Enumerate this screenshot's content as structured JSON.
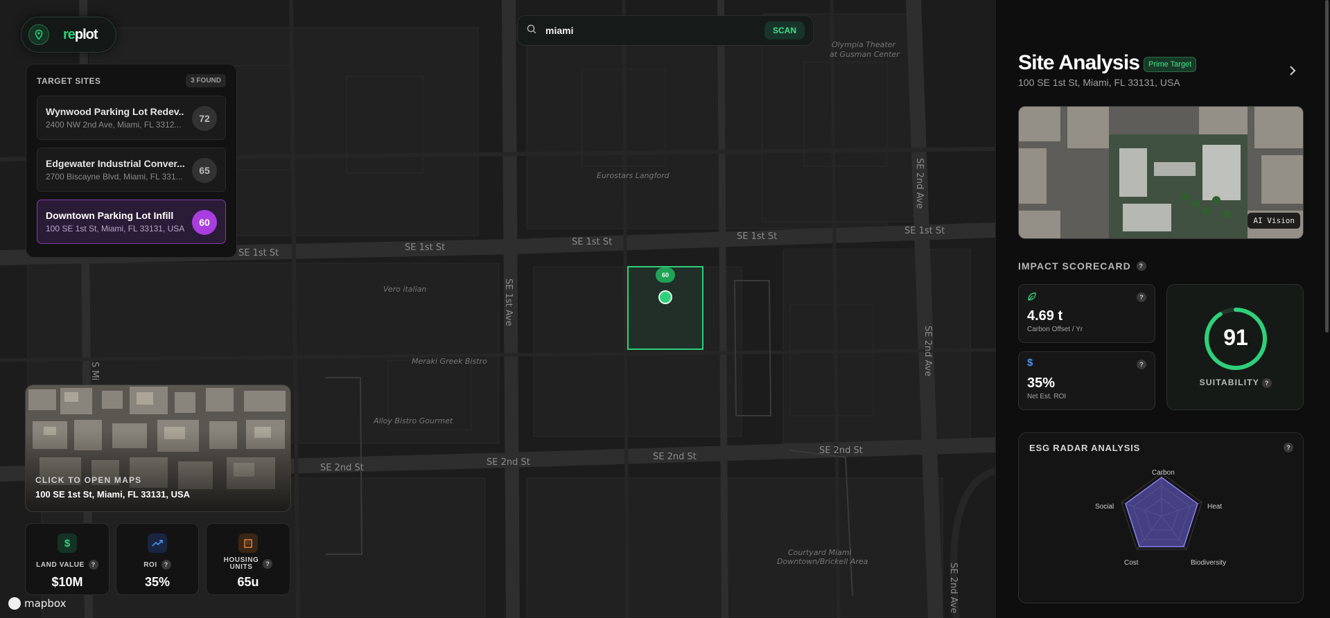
{
  "app": {
    "logo_prefix": "re",
    "logo_suffix": "plot"
  },
  "search": {
    "query": "miami",
    "scan_label": "SCAN"
  },
  "map": {
    "street_labels": [
      "SE 1st St",
      "SE 1st St",
      "SE 1st St",
      "SE 1st St",
      "SE 1st St",
      "SE 2nd St",
      "SE 2nd St",
      "SE 2nd St",
      "SE 2nd St",
      "SE 2nd Ave",
      "SE 2nd Ave",
      "SE 2nd Ave",
      "SE 1st Ave",
      "S Mi"
    ],
    "poi_labels": [
      "Olympia Theater",
      "at Gusman Center",
      "Eurostars Langford",
      "Vero italian",
      "Meraki Greek Bistro",
      "Alloy Bistro Gourmet",
      "Courtyard Miami",
      "Downtown/Brickell Area"
    ],
    "marker_score": "60",
    "attribution": "mapbox"
  },
  "sites": {
    "title": "TARGET SITES",
    "badge": "3 FOUND",
    "items": [
      {
        "name": "Wynwood Parking Lot Redev...",
        "address": "2400 NW 2nd Ave, Miami, FL 3312...",
        "score": "72"
      },
      {
        "name": "Edgewater Industrial Conver...",
        "address": "2700 Biscayne Blvd, Miami, FL 331...",
        "score": "65"
      },
      {
        "name": "Downtown Parking Lot Infill",
        "address": "100 SE 1st St, Miami, FL 33131, USA",
        "score": "60"
      }
    ]
  },
  "preview": {
    "cta": "CLICK TO OPEN MAPS",
    "address": "100 SE 1st St, Miami, FL 33131, USA"
  },
  "metrics": [
    {
      "label": "LAND VALUE",
      "value": "$10M",
      "icon": "dollar-icon"
    },
    {
      "label": "ROI",
      "value": "35%",
      "icon": "trend-up-icon"
    },
    {
      "label_line1": "HOUSING",
      "label_line2": "UNITS",
      "value": "65u",
      "icon": "building-icon"
    }
  ],
  "panel": {
    "title": "Site Analysis",
    "badge": "Prime Target",
    "address": "100 SE 1st St, Miami, FL 33131, USA",
    "aerial_tag": "AI Vision",
    "scorecard_title": "IMPACT SCORECARD",
    "carbon": {
      "value": "4.69 t",
      "label": "Carbon Offset / Yr"
    },
    "roi": {
      "value": "35%",
      "label": "Net Est. ROI"
    },
    "suitability": {
      "value": "91",
      "label": "SUITABILITY",
      "fraction": 0.91
    },
    "esg": {
      "title": "ESG RADAR ANALYSIS",
      "axes": [
        "Carbon",
        "Heat",
        "Biodiversity",
        "Cost",
        "Social"
      ]
    }
  },
  "colors": {
    "accent": "#2fd07a",
    "purple": "#a93ee0",
    "panel": "#0e0e0e"
  }
}
